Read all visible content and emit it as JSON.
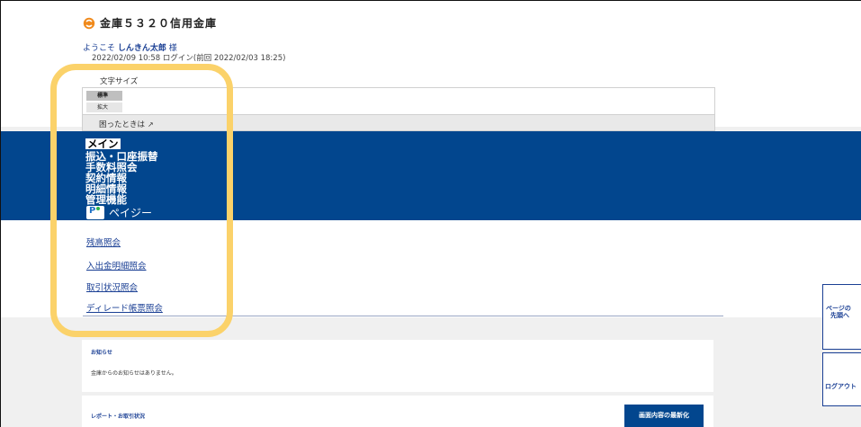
{
  "header": {
    "bank_name": "金庫５３２０信用金庫",
    "welcome_prefix": "ようこそ",
    "user_name": "しんきん太郎",
    "welcome_suffix": "様",
    "login_info": "2022/02/09 10:58 ログイン(前回 2022/02/03 18:25)"
  },
  "font_size": {
    "label": "文字サイズ",
    "standard": "標準",
    "large": "拡大"
  },
  "help": {
    "label": "困ったときは"
  },
  "nav": {
    "items": [
      "メイン",
      "振込・口座振替",
      "手数料照会",
      "契約情報",
      "明細情報",
      "管理機能"
    ],
    "payeasy_label": "ペイジー"
  },
  "submenu": {
    "items": [
      "残高照会",
      "入出金明細照会",
      "取引状況照会",
      "ディレード帳票照会"
    ]
  },
  "notices": {
    "title": "お知らせ",
    "body": "金庫からのお知らせはありません。"
  },
  "report": {
    "title": "レポート・お取引状況",
    "refresh_button": "画面内容の最新化"
  },
  "side_buttons": {
    "page_top_line1": "ページの",
    "page_top_line2": "先頭へ",
    "logout": "ログアウト"
  },
  "colors": {
    "nav_background": "#02468e",
    "link": "#1a3f94",
    "highlight": "#fbd26a"
  }
}
